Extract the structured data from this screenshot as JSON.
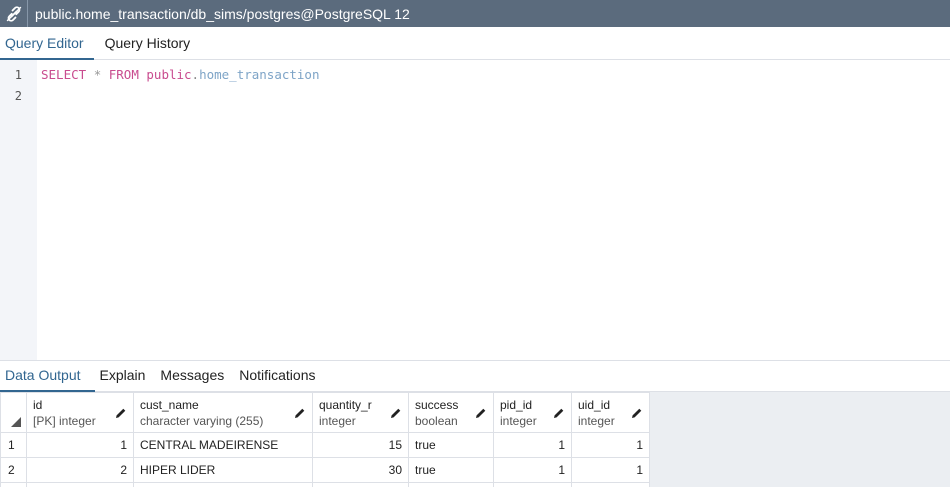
{
  "window": {
    "title": "public.home_transaction/db_sims/postgres@PostgreSQL 12",
    "icon": "connection-icon"
  },
  "editor_tabs": [
    {
      "label": "Query Editor",
      "active": true
    },
    {
      "label": "Query History",
      "active": false
    }
  ],
  "editor": {
    "line_numbers": [
      "1",
      "2"
    ],
    "code": {
      "select": "SELECT",
      "star": "*",
      "from": "FROM",
      "schema": "public",
      "dot": ".",
      "table": "home_transaction"
    }
  },
  "output_tabs": [
    {
      "label": "Data Output",
      "active": true
    },
    {
      "label": "Explain",
      "active": false
    },
    {
      "label": "Messages",
      "active": false
    },
    {
      "label": "Notifications",
      "active": false
    }
  ],
  "grid": {
    "columns": [
      {
        "name": "id",
        "type": "[PK] integer"
      },
      {
        "name": "cust_name",
        "type": "character varying (255)"
      },
      {
        "name": "quantity_r",
        "type": "integer"
      },
      {
        "name": "success",
        "type": "boolean"
      },
      {
        "name": "pid_id",
        "type": "integer"
      },
      {
        "name": "uid_id",
        "type": "integer"
      }
    ],
    "rows": [
      {
        "num": "1",
        "cells": [
          "1",
          "CENTRAL MADEIRENSE",
          "15",
          "true",
          "1",
          "1"
        ]
      },
      {
        "num": "2",
        "cells": [
          "2",
          "HIPER LIDER",
          "30",
          "true",
          "1",
          "1"
        ]
      }
    ]
  },
  "colors": {
    "titlebar": "#5b6b7d",
    "accent": "#326690",
    "keyword": "#c94c8f",
    "identifier": "#7ea4c7"
  }
}
